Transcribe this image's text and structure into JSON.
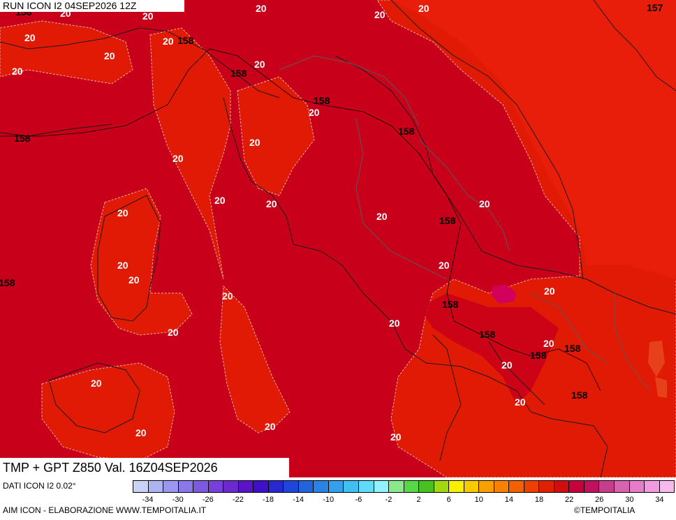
{
  "header": {
    "run_label": "RUN ICON I2 04SEP2026 12Z"
  },
  "map": {
    "title": "TMP + GPT Z850 Val. 16Z04SEP2026",
    "colors": {
      "base": "#c8001a",
      "warm": "#e01a04",
      "bright": "#e81e0a",
      "hot": "#d2005a"
    },
    "isotherm_labels": [
      "20",
      "20",
      "20",
      "20",
      "20",
      "20",
      "20",
      "20",
      "20",
      "20",
      "20",
      "20",
      "20",
      "20",
      "20",
      "20",
      "20",
      "20",
      "20",
      "20",
      "20",
      "20",
      "20",
      "20",
      "20",
      "20",
      "20",
      "20",
      "20",
      "20",
      "20",
      "20"
    ],
    "geopotential_labels": [
      "158",
      "158",
      "158",
      "158",
      "158",
      "158",
      "158",
      "158",
      "158",
      "158",
      "158",
      "158",
      "158",
      "157"
    ]
  },
  "footer": {
    "source": "DATI ICON I2 0.02°",
    "elaboration": "AIM ICON - ELABORAZIONE WWW.TEMPOITALIA.IT",
    "copyright": "©TEMPOITALIA"
  },
  "legend": {
    "colors": [
      "#c9d2f5",
      "#aeb4f0",
      "#9b96f0",
      "#8a78e8",
      "#7c5ae0",
      "#7840d8",
      "#6e28d0",
      "#5a14c8",
      "#4010c8",
      "#2828d0",
      "#1e46d8",
      "#2264dc",
      "#2a82e4",
      "#34a0ec",
      "#40c0f2",
      "#60dcf8",
      "#90f2fa",
      "#8ce88c",
      "#58d844",
      "#48c020",
      "#a0d814",
      "#f8f000",
      "#f8c800",
      "#f8a000",
      "#f88200",
      "#f46000",
      "#ec4000",
      "#e02000",
      "#d00e10",
      "#c8003c",
      "#c01060",
      "#c83c8c",
      "#d862b0",
      "#e87ccc",
      "#f498e0",
      "#fab8ee"
    ],
    "ticks": [
      "-34",
      "-30",
      "-26",
      "-22",
      "-18",
      "-14",
      "-10",
      "-6",
      "-2",
      "2",
      "6",
      "10",
      "14",
      "18",
      "22",
      "26",
      "30",
      "34"
    ]
  }
}
